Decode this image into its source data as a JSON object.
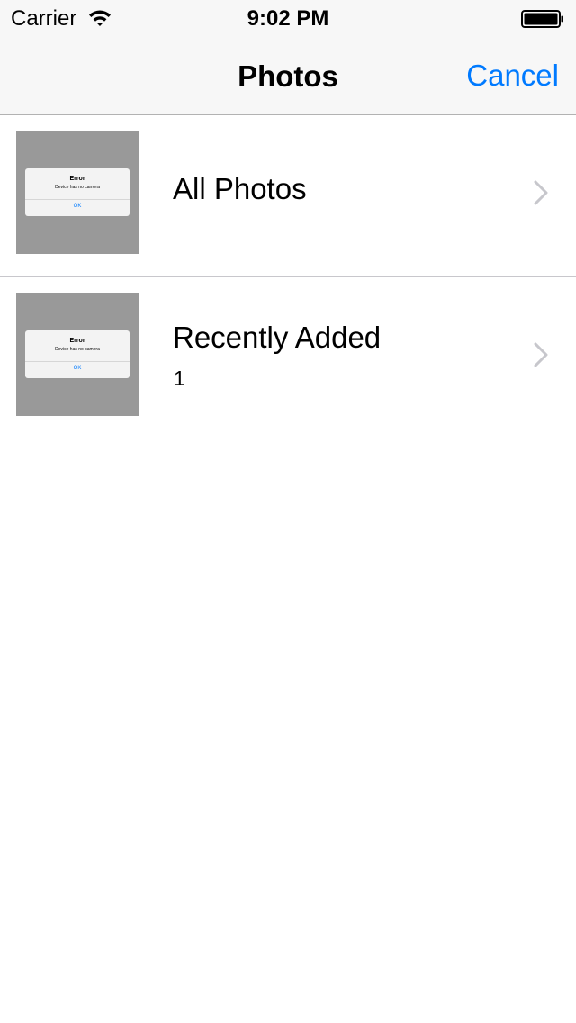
{
  "status_bar": {
    "carrier": "Carrier",
    "time": "9:02 PM",
    "wifi_icon": "wifi-icon",
    "battery_icon": "battery-icon"
  },
  "nav_bar": {
    "title": "Photos",
    "cancel_label": "Cancel",
    "accent_color": "#007aff"
  },
  "albums": [
    {
      "title": "All Photos",
      "count": "",
      "thumbnail": {
        "alert_title": "Error",
        "alert_message": "Device has no camera",
        "alert_button": "OK"
      },
      "chevron_icon": "chevron-right-icon"
    },
    {
      "title": "Recently Added",
      "count": "1",
      "thumbnail": {
        "alert_title": "Error",
        "alert_message": "Device has no camera",
        "alert_button": "OK"
      },
      "chevron_icon": "chevron-right-icon"
    }
  ]
}
